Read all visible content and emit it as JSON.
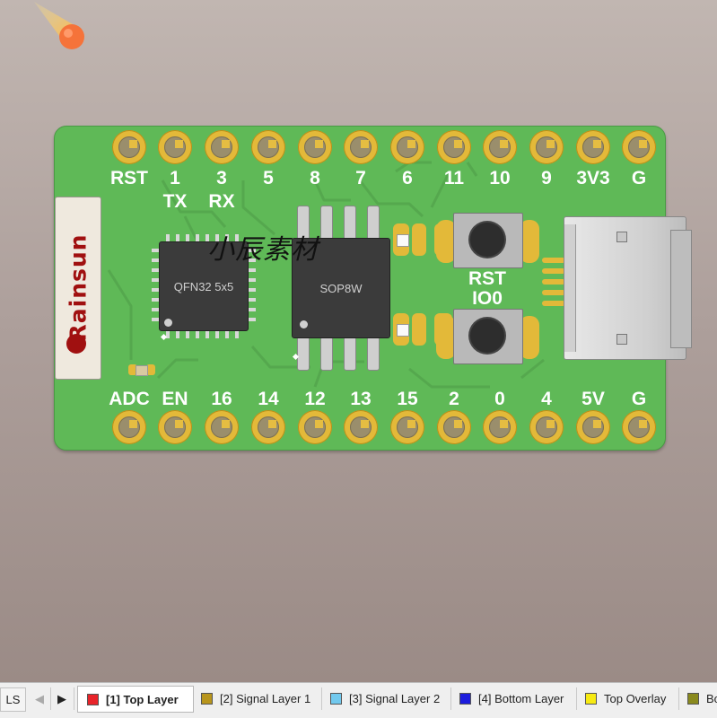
{
  "board": {
    "top_pins": [
      "RST",
      "1",
      "3",
      "5",
      "8",
      "7",
      "6",
      "11",
      "10",
      "9",
      "3V3",
      "G"
    ],
    "top_sublabels": [
      "",
      "TX",
      "RX",
      "",
      "",
      "",
      "",
      "",
      "",
      "",
      "",
      ""
    ],
    "bottom_pins": [
      "ADC",
      "EN",
      "16",
      "14",
      "12",
      "13",
      "15",
      "2",
      "0",
      "4",
      "5V",
      "G"
    ],
    "antenna_brand": "Rainsun",
    "qfn_label": "QFN32 5x5",
    "sop_label": "SOP8W",
    "rst_button_label": "RST",
    "io0_button_label": "IO0",
    "watermark": "小辰素材",
    "colors": {
      "board": "#5fb957",
      "pad": "#e3b939",
      "silkscreen": "#ffffff",
      "antenna_text": "#a01010"
    }
  },
  "layer_bar": {
    "ls_label": "LS",
    "layers": [
      {
        "name": "[1] Top Layer",
        "color": "#e8242a",
        "active": true
      },
      {
        "name": "[2] Signal Layer 1",
        "color": "#b8951c",
        "active": false
      },
      {
        "name": "[3] Signal Layer 2",
        "color": "#72c9ee",
        "active": false
      },
      {
        "name": "[4] Bottom Layer",
        "color": "#1c1cdd",
        "active": false
      },
      {
        "name": "Top Overlay",
        "color": "#f7ea12",
        "active": false
      },
      {
        "name": "Bo",
        "color": "#8a8a1e",
        "active": false
      }
    ],
    "icons": [
      "chevron-left-icon",
      "chevron-right-icon"
    ]
  }
}
